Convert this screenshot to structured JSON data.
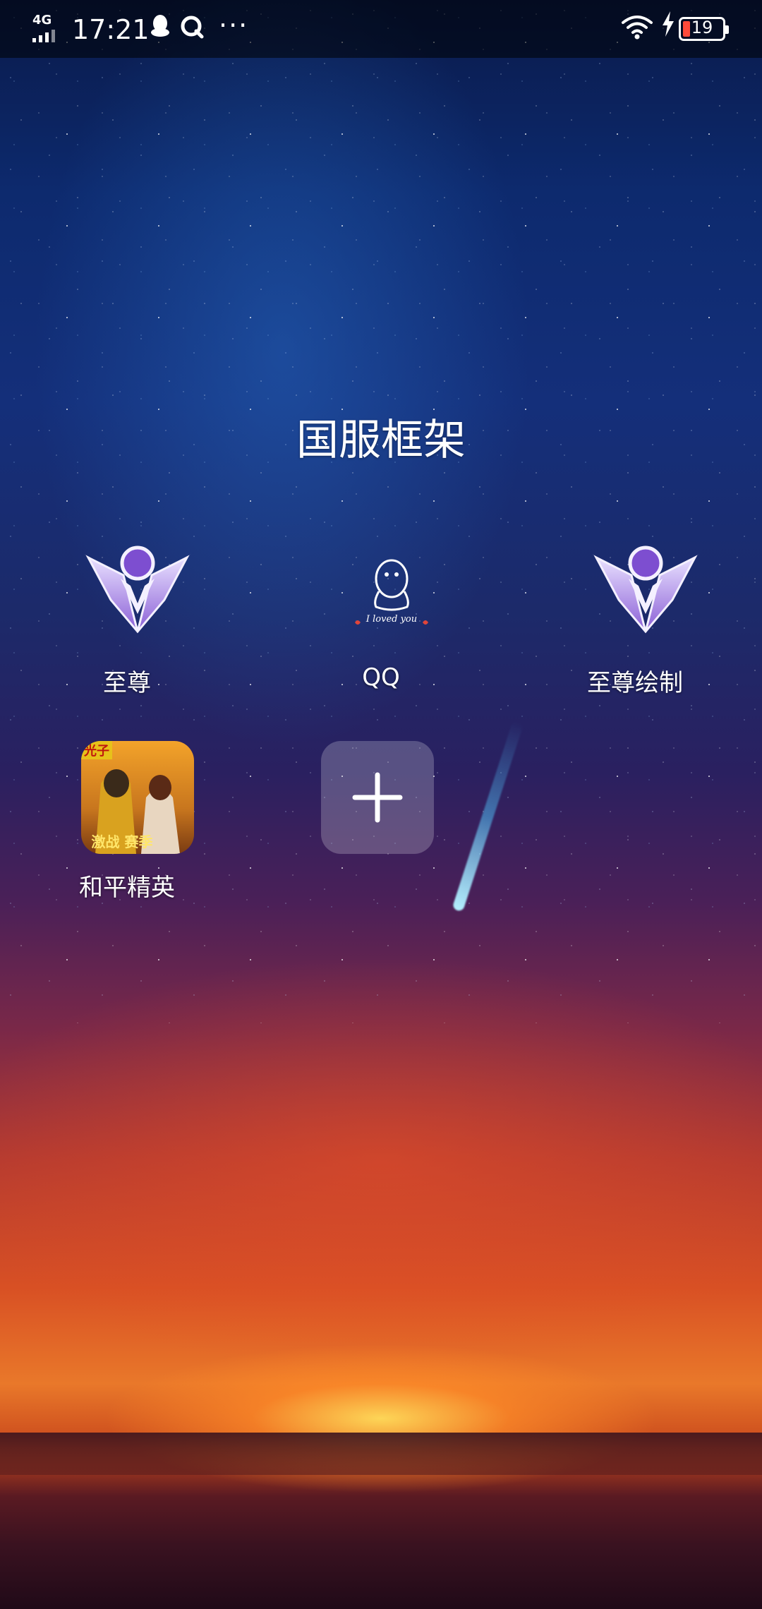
{
  "status_bar": {
    "network": "4G",
    "time": "17:21",
    "more": "···",
    "battery_level": "19",
    "battery_fraction": 0.19,
    "battery_color": "#ff4a3a"
  },
  "folder": {
    "title": "国服框架",
    "apps": [
      {
        "label": "至尊",
        "icon": "supreme-emblem-icon"
      },
      {
        "label": "QQ",
        "icon": "qq-penguin-icon",
        "caption": "I loved you"
      },
      {
        "label": "至尊绘制",
        "icon": "supreme-emblem-icon"
      },
      {
        "label": "和平精英",
        "icon": "peace-elite-game-icon",
        "badge_top": "光子",
        "badge_bottom": "激战 赛季"
      }
    ],
    "add_button": {
      "icon": "plus-icon"
    }
  }
}
